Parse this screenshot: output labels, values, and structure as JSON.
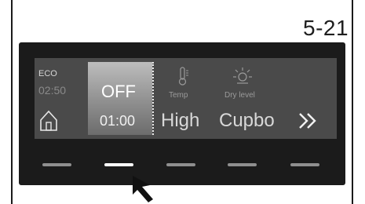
{
  "figure": {
    "label": "5-21"
  },
  "display": {
    "eco": {
      "label": "ECO",
      "time": "02:50"
    },
    "home_icon": "home-icon",
    "timer": {
      "state": "OFF",
      "value": "01:00",
      "selected": true
    },
    "temp": {
      "icon": "thermometer-icon",
      "label": "Temp",
      "value": "High"
    },
    "dry_level": {
      "icon": "sun-icon",
      "label": "Dry level",
      "value": "Cupbo"
    },
    "next_icon": "double-chevron-right-icon"
  },
  "touch_keys": {
    "count": 5,
    "active_index": 1
  },
  "colors": {
    "panel": "#1b1b1b",
    "display": "#4a4a4a",
    "selected": "#a6a6a6",
    "key_inactive": "#8f8f8f",
    "key_active": "#ffffff"
  }
}
